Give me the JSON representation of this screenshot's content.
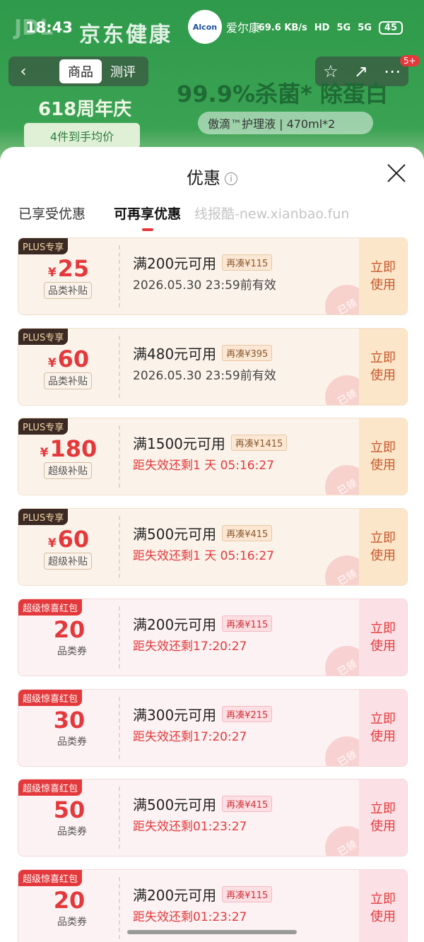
{
  "status_bar": {
    "time": "18:43",
    "net_speed": "69.6 KB/s",
    "hd": "HD",
    "net1": "5G",
    "net2": "5G",
    "battery": "45"
  },
  "background": {
    "brand_faint": "JDL",
    "brand_name": "京东健康",
    "partner_logo": "Alcon",
    "partner_name": "爱尔康",
    "tabs": [
      "商品",
      "测评"
    ],
    "notification_count": "5+",
    "promo_618": "618周年庆",
    "promo_pill": "4件到手均价",
    "headline": "99.9%杀菌* 除蛋白",
    "subline": "傲滴™护理液 | 470ml*2"
  },
  "sheet": {
    "title": "优惠",
    "tabs": [
      "已享受优惠",
      "可再享优惠"
    ],
    "active_tab": 1,
    "watermark": "线报酷-new.xianbao.fun"
  },
  "coupons": [
    {
      "tag": "PLUS专享",
      "style": "plus",
      "currency": "¥",
      "amount": "25",
      "kind": "品类补贴",
      "condition": "满200元可用",
      "badge": "再凑¥115",
      "validity": "2026.05.30 23:59前有效",
      "countdown": false,
      "stamp": "已领",
      "action": "立即使用"
    },
    {
      "tag": "PLUS专享",
      "style": "plus",
      "currency": "¥",
      "amount": "60",
      "kind": "品类补贴",
      "condition": "满480元可用",
      "badge": "再凑¥395",
      "validity": "2026.05.30 23:59前有效",
      "countdown": false,
      "stamp": "已领",
      "action": "立即使用"
    },
    {
      "tag": "PLUS专享",
      "style": "plus",
      "currency": "¥",
      "amount": "180",
      "kind": "超级补贴",
      "condition": "满1500元可用",
      "badge": "再凑¥1415",
      "validity": "距失效还剩1 天 05:16:27",
      "countdown": true,
      "stamp": "已领",
      "action": "立即使用"
    },
    {
      "tag": "PLUS专享",
      "style": "plus",
      "currency": "¥",
      "amount": "60",
      "kind": "超级补贴",
      "condition": "满500元可用",
      "badge": "再凑¥415",
      "validity": "距失效还剩1 天 05:16:27",
      "countdown": true,
      "stamp": "已领",
      "action": "立即使用"
    },
    {
      "tag": "超级惊喜红包",
      "style": "red",
      "currency": "",
      "amount": "20",
      "kind": "品类券",
      "condition": "满200元可用",
      "badge": "再凑¥115",
      "validity": "距失效还剩17:20:27",
      "countdown": true,
      "stamp": "已领",
      "action": "立即使用"
    },
    {
      "tag": "超级惊喜红包",
      "style": "red",
      "currency": "",
      "amount": "30",
      "kind": "品类券",
      "condition": "满300元可用",
      "badge": "再凑¥215",
      "validity": "距失效还剩17:20:27",
      "countdown": true,
      "stamp": "已领",
      "action": "立即使用"
    },
    {
      "tag": "超级惊喜红包",
      "style": "red",
      "currency": "",
      "amount": "50",
      "kind": "品类券",
      "condition": "满500元可用",
      "badge": "再凑¥415",
      "validity": "距失效还剩01:23:27",
      "countdown": true,
      "stamp": "已领",
      "action": "立即使用"
    },
    {
      "tag": "超级惊喜红包",
      "style": "red",
      "currency": "",
      "amount": "20",
      "kind": "品类券",
      "condition": "满200元可用",
      "badge": "再凑¥115",
      "validity": "距失效还剩01:23:27",
      "countdown": true,
      "stamp": "",
      "action": "立即使用"
    }
  ]
}
